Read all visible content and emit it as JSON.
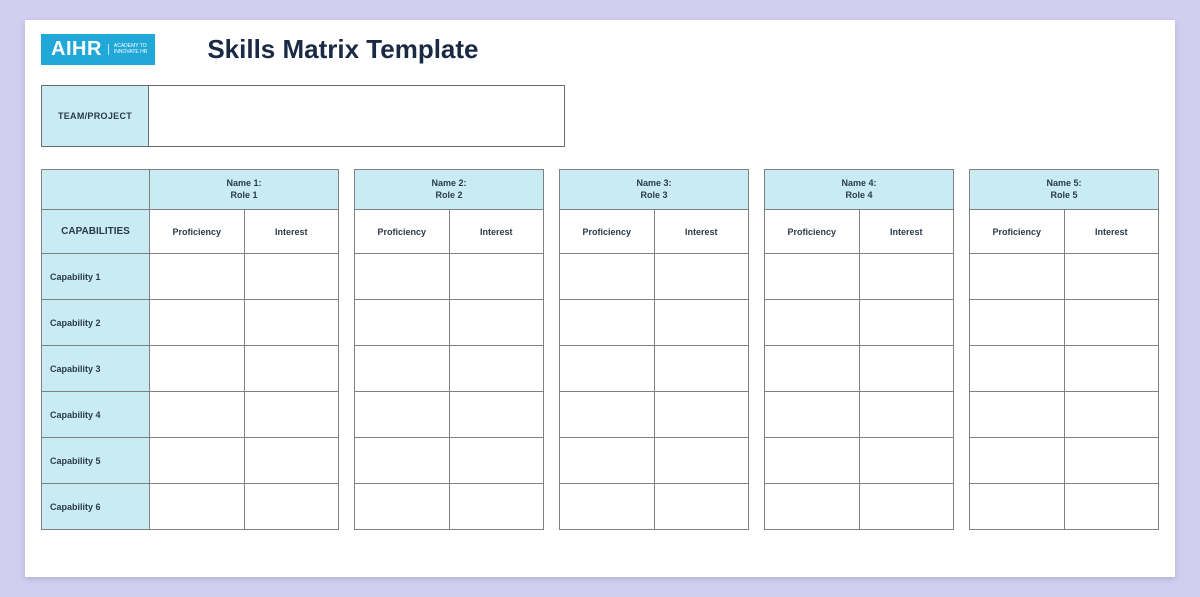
{
  "logo": {
    "main": "AIHR",
    "sub1": "ACADEMY TO",
    "sub2": "INNOVATE HR"
  },
  "title": "Skills Matrix Template",
  "team_label": "TEAM/PROJECT",
  "team_value": "",
  "capabilities_heading": "CAPABILITIES",
  "sub_headings": {
    "proficiency": "Proficiency",
    "interest": "Interest"
  },
  "members": [
    {
      "name": "Name 1:",
      "role": "Role 1"
    },
    {
      "name": "Name 2:",
      "role": "Role 2"
    },
    {
      "name": "Name 3:",
      "role": "Role 3"
    },
    {
      "name": "Name 4:",
      "role": "Role 4"
    },
    {
      "name": "Name 5:",
      "role": "Role 5"
    }
  ],
  "capabilities": [
    "Capability 1",
    "Capability 2",
    "Capability 3",
    "Capability 4",
    "Capability 5",
    "Capability 6"
  ]
}
